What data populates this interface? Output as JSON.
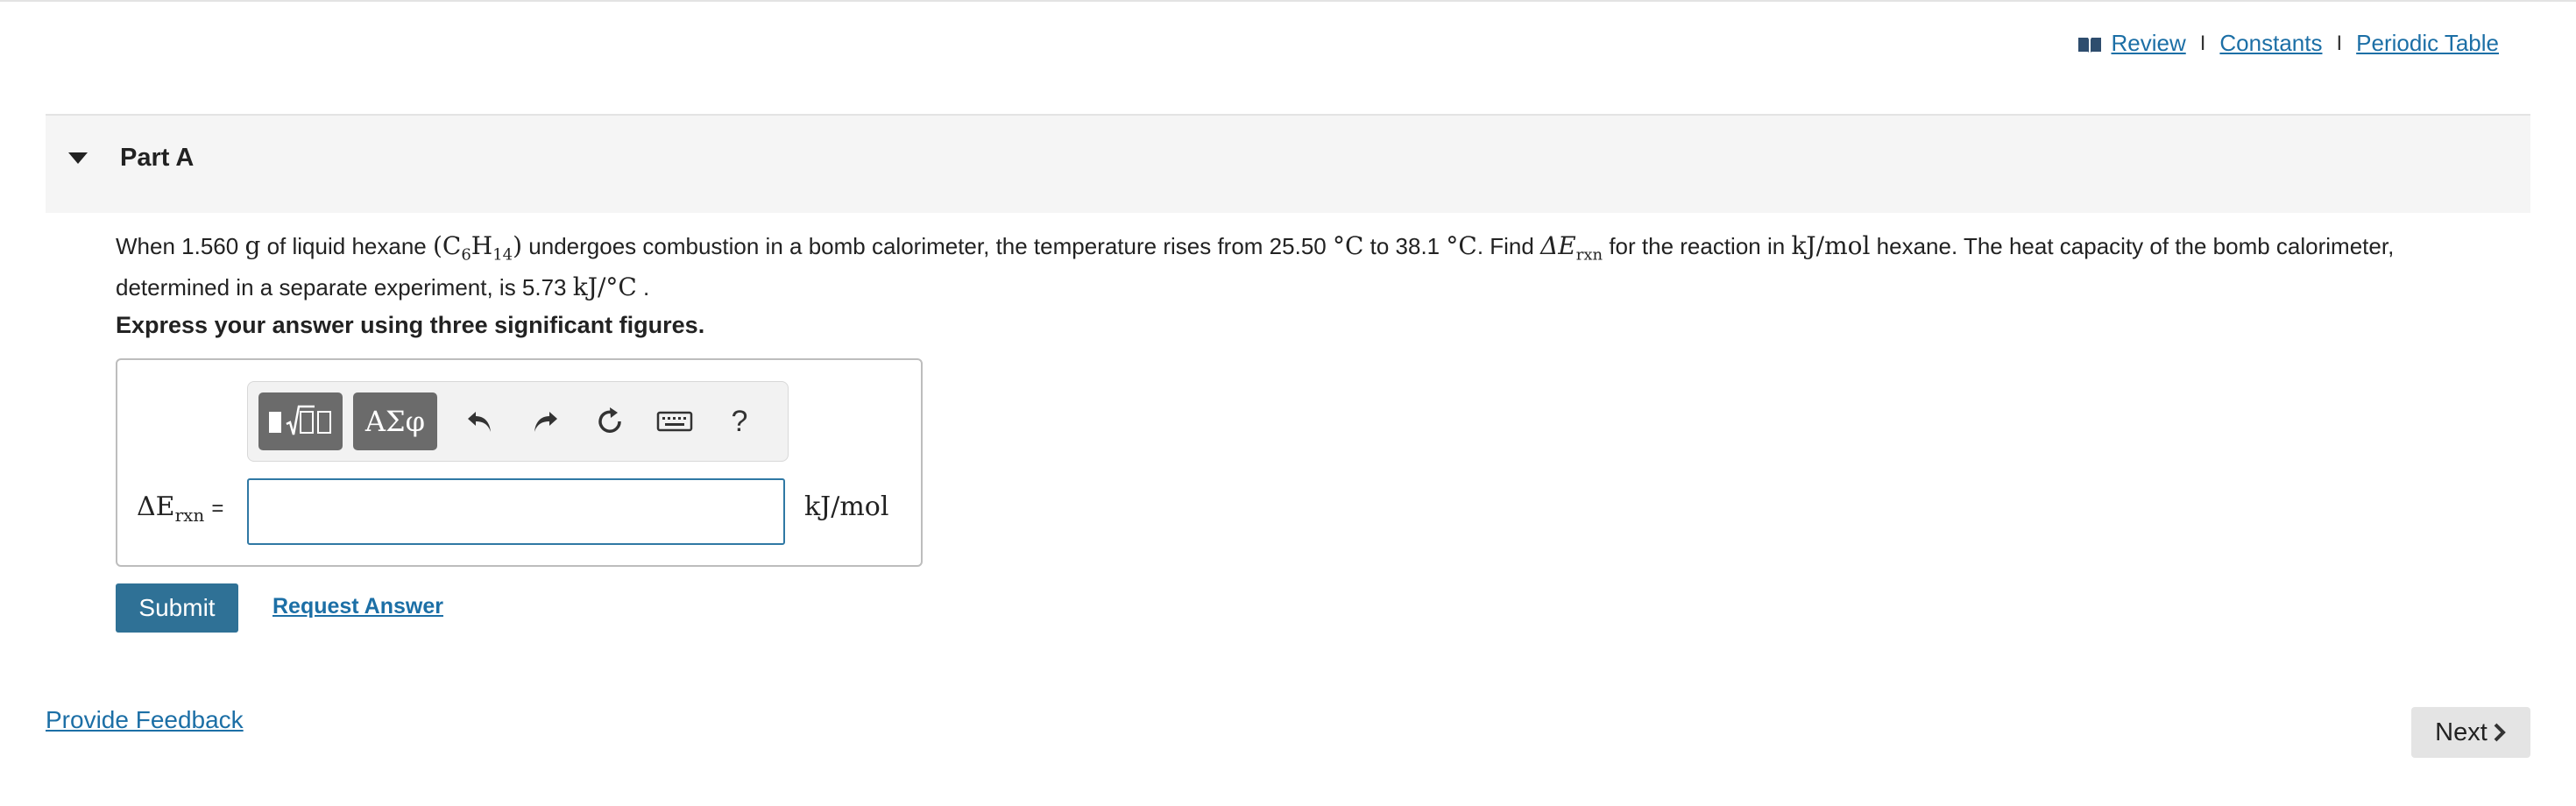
{
  "header_links": {
    "review": "Review",
    "constants": "Constants",
    "periodic_table": "Periodic Table",
    "separator": "I"
  },
  "part": {
    "title": "Part A"
  },
  "question": {
    "t1": "When 1.560 ",
    "g": "g",
    "t2": " of liquid hexane ",
    "formula_open": "(C",
    "c_sub": "6",
    "formula_h": "H",
    "h_sub": "14",
    "formula_close": ")",
    "t3": " undergoes combustion in a bomb calorimeter, the temperature rises from 25.50 ",
    "deg1": "°C",
    "t4": " to 38.1 ",
    "deg2": "°C",
    "t5": ". Find ",
    "delta_e": "ΔE",
    "rxn": "rxn",
    "t6": " for the reaction in ",
    "unit": "kJ/mol",
    "t7": " hexane. The heat capacity of the bomb calorimeter, determined in a separate experiment, is 5.73 ",
    "cap_unit": "kJ/°C",
    "t8": " ."
  },
  "instruction": "Express your answer using three significant figures.",
  "toolbar": {
    "templates_label": "■√□",
    "symbols_label": "ΑΣφ",
    "help_label": "?"
  },
  "answer": {
    "label_main": "ΔE",
    "label_sub": "rxn",
    "equals": "=",
    "value": "",
    "unit": "kJ/mol"
  },
  "actions": {
    "submit": "Submit",
    "request_answer": "Request Answer"
  },
  "footer": {
    "feedback": "Provide Feedback",
    "next": "Next"
  },
  "colors": {
    "link": "#1c6fa6",
    "submit_bg": "#2f7196",
    "input_border": "#2f78a4",
    "header_band": "#f5f5f5",
    "toolbar_button": "#6b6b6b"
  },
  "icons": {
    "review": "book-icon",
    "collapse": "caret-down-icon",
    "undo": "undo-icon",
    "redo": "redo-icon",
    "reset": "reset-icon",
    "keyboard": "keyboard-icon",
    "help": "question-mark-icon",
    "next": "chevron-right-icon"
  }
}
